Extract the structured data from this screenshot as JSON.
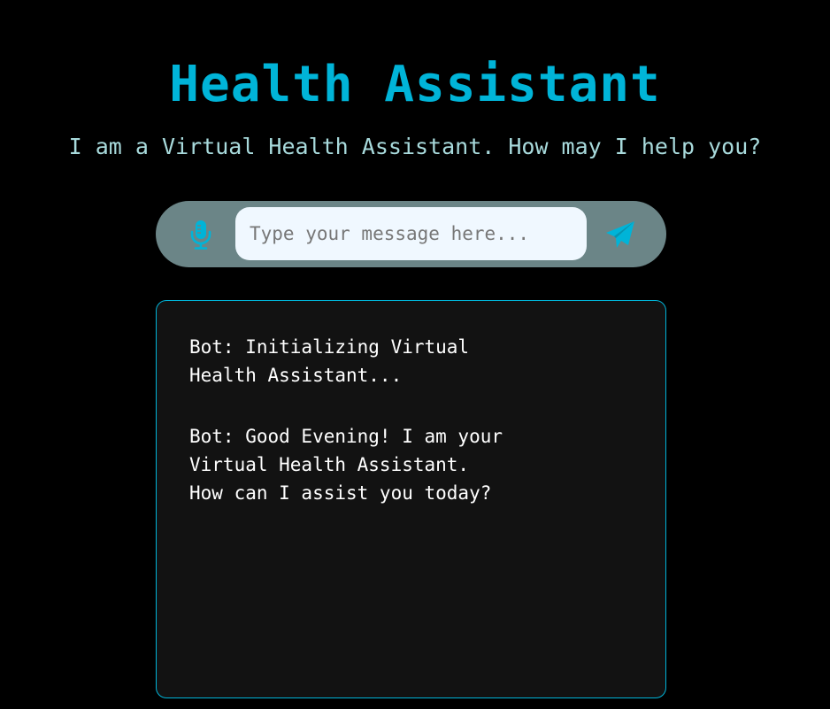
{
  "header": {
    "title": "Health Assistant",
    "subtitle": "I am a Virtual Health Assistant. How may I help you?"
  },
  "input_bar": {
    "mic_icon": "microphone-icon",
    "placeholder": "Type your message here...",
    "value": "",
    "send_icon": "paper-plane-icon"
  },
  "chat": {
    "messages": [
      {
        "text": "Bot: Initializing Virtual\nHealth Assistant..."
      },
      {
        "text": "Bot: Good Evening! I am your\nVirtual Health Assistant.\nHow can I assist you today?"
      }
    ]
  },
  "colors": {
    "background": "#000000",
    "accent": "#00b4d8",
    "subtitle": "#a8dadc",
    "input_bar": "#6b8587",
    "input_field": "#f0f8ff",
    "chat_box": "#121212",
    "message_text": "#ffffff"
  }
}
